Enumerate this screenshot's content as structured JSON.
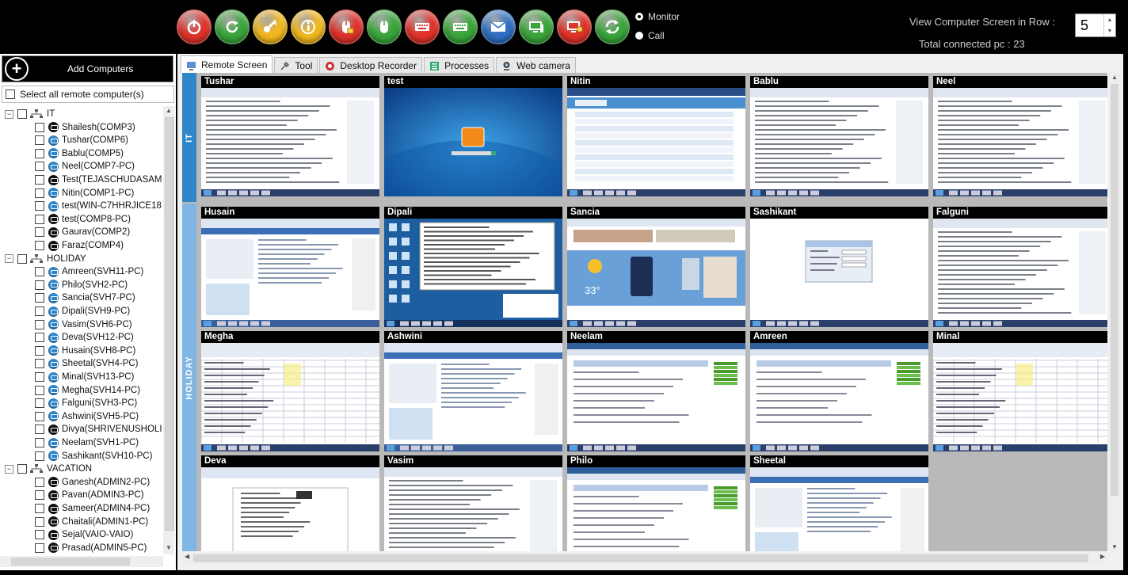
{
  "toolbar": {
    "buttons": [
      {
        "name": "power",
        "color": "#e0322a"
      },
      {
        "name": "refresh",
        "color": "#3aa53a"
      },
      {
        "name": "key",
        "color": "#f2b81e"
      },
      {
        "name": "info",
        "color": "#f2b81e"
      },
      {
        "name": "mouse-lock",
        "color": "#e0322a"
      },
      {
        "name": "mouse",
        "color": "#3aa53a"
      },
      {
        "name": "keyboard-lock",
        "color": "#e0322a"
      },
      {
        "name": "keyboard",
        "color": "#3aa53a"
      },
      {
        "name": "message",
        "color": "#2f6fc2"
      },
      {
        "name": "monitor",
        "color": "#3aa53a"
      },
      {
        "name": "monitor-lock",
        "color": "#e0322a"
      },
      {
        "name": "sync",
        "color": "#3aa53a"
      }
    ],
    "monitor_label": "Monitor",
    "call_label": "Call",
    "selected_mode": "Monitor",
    "view_label": "View Computer Screen in Row :",
    "row_value": "5",
    "total_label": "Total connected pc : 23"
  },
  "left": {
    "add_label": "Add Computers",
    "select_all_label": "Select all remote computer(s)",
    "groups": [
      {
        "label": "IT",
        "items": [
          {
            "label": "Shailesh(COMP3)",
            "online": false
          },
          {
            "label": "Tushar(COMP6)",
            "online": true
          },
          {
            "label": "Bablu(COMP5)",
            "online": true
          },
          {
            "label": "Neel(COMP7-PC)",
            "online": true
          },
          {
            "label": "Test(TEJASCHUDASAM",
            "online": false
          },
          {
            "label": "Nitin(COMP1-PC)",
            "online": true
          },
          {
            "label": "test(WIN-C7HHRJICE18",
            "online": true
          },
          {
            "label": "test(COMP8-PC)",
            "online": false
          },
          {
            "label": "Gaurav(COMP2)",
            "online": false
          },
          {
            "label": "Faraz(COMP4)",
            "online": false
          }
        ]
      },
      {
        "label": "HOLIDAY",
        "items": [
          {
            "label": "Amreen(SVH11-PC)",
            "online": true
          },
          {
            "label": "Philo(SVH2-PC)",
            "online": true
          },
          {
            "label": "Sancia(SVH7-PC)",
            "online": true
          },
          {
            "label": "Dipali(SVH9-PC)",
            "online": true
          },
          {
            "label": "Vasim(SVH6-PC)",
            "online": true
          },
          {
            "label": "Deva(SVH12-PC)",
            "online": true
          },
          {
            "label": "Husain(SVH8-PC)",
            "online": true
          },
          {
            "label": "Sheetal(SVH4-PC)",
            "online": true
          },
          {
            "label": "Minal(SVH13-PC)",
            "online": true
          },
          {
            "label": "Megha(SVH14-PC)",
            "online": true
          },
          {
            "label": "Falguni(SVH3-PC)",
            "online": true
          },
          {
            "label": "Ashwini(SVH5-PC)",
            "online": true
          },
          {
            "label": "Divya(SHRIVENUSHOLI",
            "online": false
          },
          {
            "label": "Neelam(SVH1-PC)",
            "online": true
          },
          {
            "label": "Sashikant(SVH10-PC)",
            "online": true
          }
        ]
      },
      {
        "label": "VACATION",
        "items": [
          {
            "label": "Ganesh(ADMIN2-PC)",
            "online": false
          },
          {
            "label": "Pavan(ADMIN3-PC)",
            "online": false
          },
          {
            "label": "Sameer(ADMIN4-PC)",
            "online": false
          },
          {
            "label": "Chaitali(ADMIN1-PC)",
            "online": false
          },
          {
            "label": "Sejal(VAIO-VAIO)",
            "online": false
          },
          {
            "label": "Prasad(ADMIN5-PC)",
            "online": false
          }
        ]
      }
    ]
  },
  "tabs": [
    "Remote Screen",
    "Tool",
    "Desktop Recorder",
    "Processes",
    "Web camera"
  ],
  "active_tab": "Remote Screen",
  "screen_groups": [
    "IT",
    "HOLIDAY"
  ],
  "weather_temp": "33°",
  "tiles": [
    {
      "name": "Tushar",
      "style": "doc"
    },
    {
      "name": "test",
      "style": "win7"
    },
    {
      "name": "Nitin",
      "style": "table"
    },
    {
      "name": "Bablu",
      "style": "doc"
    },
    {
      "name": "Neel",
      "style": "doc"
    },
    {
      "name": "Husain",
      "style": "web"
    },
    {
      "name": "Dipali",
      "style": "desktop"
    },
    {
      "name": "Sancia",
      "style": "weather"
    },
    {
      "name": "Sashikant",
      "style": "dialog"
    },
    {
      "name": "Falguni",
      "style": "doc"
    },
    {
      "name": "Megha",
      "style": "sheet"
    },
    {
      "name": "Ashwini",
      "style": "web"
    },
    {
      "name": "Neelam",
      "style": "form"
    },
    {
      "name": "Amreen",
      "style": "form"
    },
    {
      "name": "Minal",
      "style": "sheet"
    },
    {
      "name": "Deva",
      "style": "paper"
    },
    {
      "name": "Vasim",
      "style": "doc"
    },
    {
      "name": "Philo",
      "style": "form"
    },
    {
      "name": "Sheetal",
      "style": "web"
    }
  ],
  "status_colors": {
    "online": "#2f86c9",
    "offline": "#111111"
  }
}
